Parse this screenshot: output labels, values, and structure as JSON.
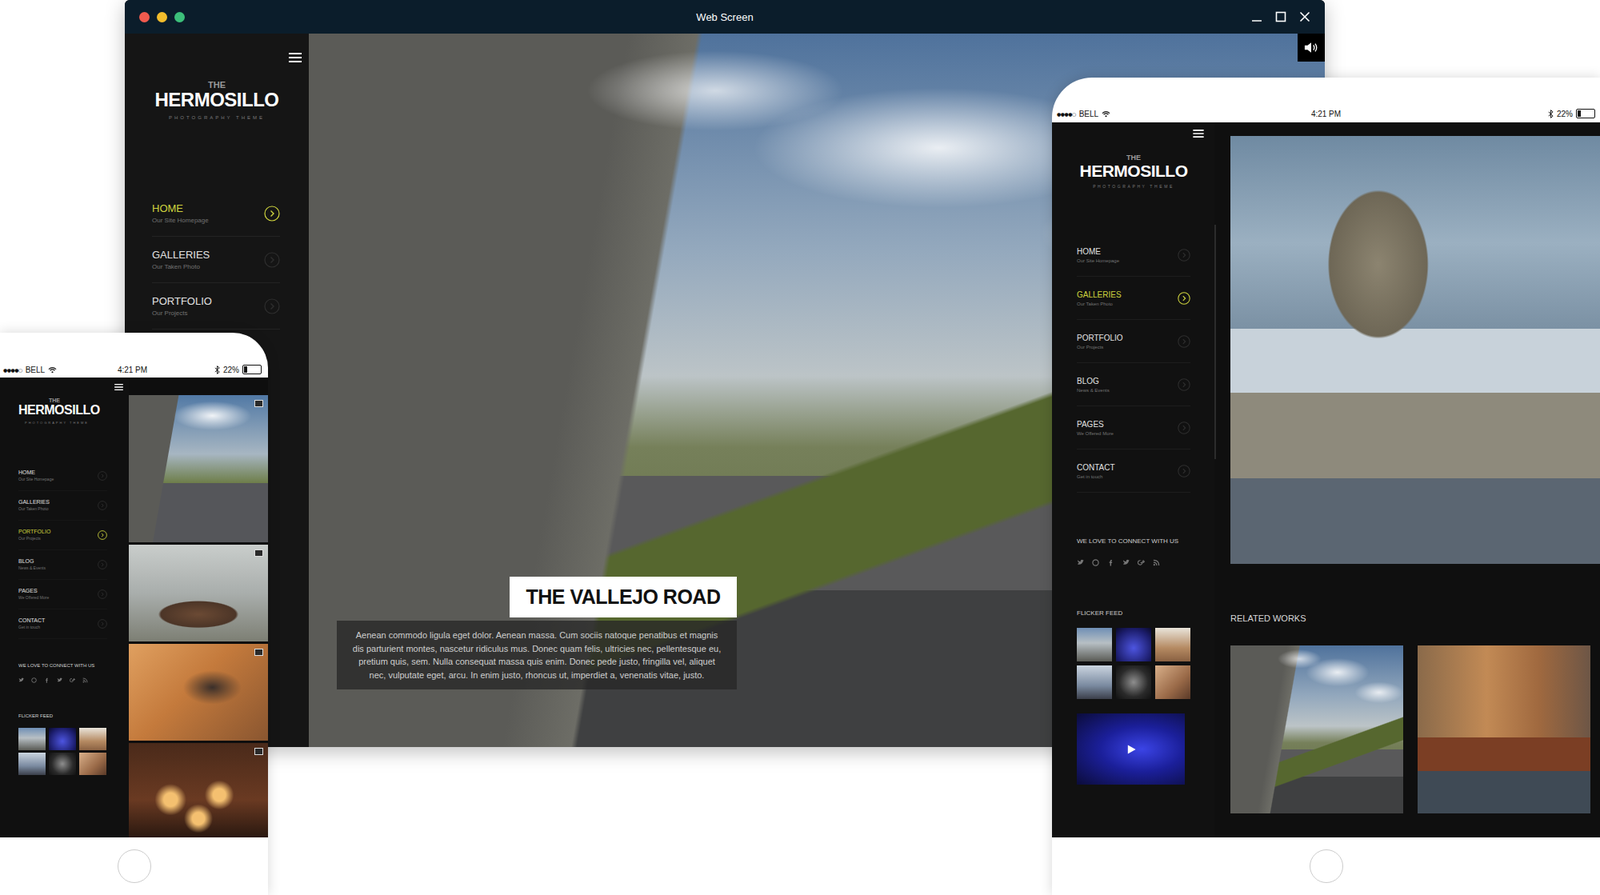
{
  "window": {
    "title": "Web Screen"
  },
  "brand": {
    "prefix": "THE",
    "name": "HERMOSILLO",
    "tagline": "PHOTOGRAPHY THEME"
  },
  "desktop": {
    "menu": [
      {
        "label": "HOME",
        "sub": "Our Site Homepage",
        "selected": true
      },
      {
        "label": "GALLERIES",
        "sub": "Our Taken Photo",
        "selected": false
      },
      {
        "label": "PORTFOLIO",
        "sub": "Our Projects",
        "selected": false
      }
    ],
    "caption": {
      "title": "THE VALLEJO ROAD",
      "text": "Aenean commodo ligula eget dolor. Aenean massa. Cum sociis natoque penatibus et magnis dis parturient montes, nascetur ridiculus mus. Donec quam felis, ultricies nec, pellentesque eu, pretium quis, sem. Nulla consequat massa quis enim. Donec pede justo, fringilla vel, aliquet nec, vulputate eget, arcu. In enim justo, rhoncus ut, imperdiet a, venenatis vitae, justo."
    }
  },
  "status_bar": {
    "signal": "●●●●○",
    "carrier": "BELL",
    "time": "4:21 PM",
    "battery": "22%",
    "battery_level": 0.22
  },
  "phone": {
    "menu": [
      {
        "label": "HOME",
        "sub": "Our Site Homepage",
        "selected": false
      },
      {
        "label": "GALLERIES",
        "sub": "Our Taken Photo",
        "selected": false
      },
      {
        "label": "PORTFOLIO",
        "sub": "Our Projects",
        "selected": true
      },
      {
        "label": "BLOG",
        "sub": "News & Events",
        "selected": false
      },
      {
        "label": "PAGES",
        "sub": "We Offered More",
        "selected": false
      },
      {
        "label": "CONTACT",
        "sub": "Get in touch",
        "selected": false
      }
    ],
    "connect": "WE LOVE TO CONNECT WITH US",
    "feed": "FLICKER FEED"
  },
  "tablet": {
    "menu": [
      {
        "label": "HOME",
        "sub": "Our Site Homepage",
        "selected": false
      },
      {
        "label": "GALLERIES",
        "sub": "Our Taken Photo",
        "selected": true
      },
      {
        "label": "PORTFOLIO",
        "sub": "Our Projects",
        "selected": false
      },
      {
        "label": "BLOG",
        "sub": "News & Events",
        "selected": false
      },
      {
        "label": "PAGES",
        "sub": "We Offered More",
        "selected": false
      },
      {
        "label": "CONTACT",
        "sub": "Get in touch",
        "selected": false
      }
    ],
    "connect": "WE LOVE TO CONNECT WITH US",
    "feed": "FLICKER FEED",
    "related": "RELATED WORKS"
  }
}
